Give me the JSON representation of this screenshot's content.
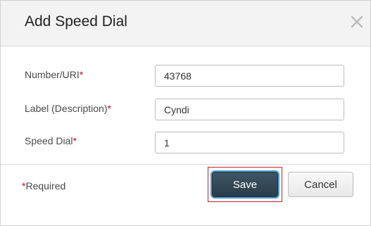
{
  "dialog": {
    "title": "Add Speed Dial",
    "close_icon": "close-icon"
  },
  "form": {
    "fields": [
      {
        "label": "Number/URI",
        "required_mark": "*",
        "value": "43768"
      },
      {
        "label": "Label (Description)",
        "required_mark": "*",
        "value": "Cyndi"
      },
      {
        "label": "Speed Dial",
        "required_mark": "*",
        "value": "1"
      }
    ]
  },
  "footer": {
    "required_mark": "*",
    "required_text": "Required",
    "save_label": "Save",
    "cancel_label": "Cancel"
  },
  "colors": {
    "required_mark": "#d0021b",
    "save_button": "#2f4350",
    "highlight_box": "#c4222a"
  }
}
